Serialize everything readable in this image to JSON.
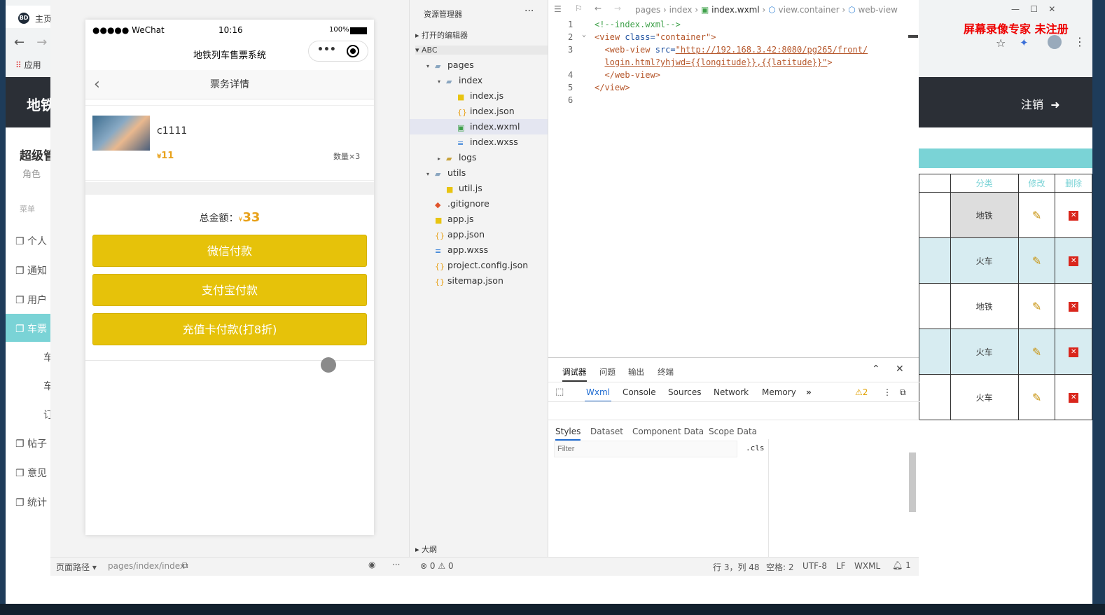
{
  "bg_browser": {
    "tab_label": "主页",
    "apps_label": "应用",
    "brand": "地铁",
    "logout": "注销",
    "side_title": "超级管",
    "side_role": "角色",
    "menu_label": "菜单",
    "side_items": [
      "个人",
      "通知",
      "用户",
      "车票",
      "车",
      "车",
      "订",
      "帖子",
      "意见",
      "统计"
    ],
    "table_headers": [
      "分类",
      "修改",
      "删除"
    ],
    "table_rows": [
      "地铁",
      "火车",
      "地铁",
      "火车",
      "火车"
    ],
    "watermark": "屏幕录像专家  未注册"
  },
  "simulator": {
    "status": {
      "carrier": "●●●●● WeChat",
      "time": "10:16",
      "battery": "100%"
    },
    "nav_title": "地铁列车售票系统",
    "page_title": "票务详情",
    "ticket": {
      "name": "c1111",
      "price_symbol": "¥",
      "price": "11",
      "qty": "数量×3"
    },
    "total_label": "总金额：",
    "total_symbol": "¥",
    "total_value": "33",
    "buttons": [
      "微信付款",
      "支付宝付款",
      "充值卡付款(打8折)"
    ]
  },
  "explorer": {
    "title": "资源管理器",
    "open_editors": "打开的编辑器",
    "project": "ABC",
    "outline": "大纲",
    "tree": [
      {
        "label": "pages",
        "depth": 1,
        "type": "folder-open"
      },
      {
        "label": "index",
        "depth": 2,
        "type": "folder-open"
      },
      {
        "label": "index.js",
        "depth": 3,
        "type": "js"
      },
      {
        "label": "index.json",
        "depth": 3,
        "type": "json"
      },
      {
        "label": "index.wxml",
        "depth": 3,
        "type": "wxml",
        "selected": true
      },
      {
        "label": "index.wxss",
        "depth": 3,
        "type": "wxss"
      },
      {
        "label": "logs",
        "depth": 2,
        "type": "folder"
      },
      {
        "label": "utils",
        "depth": 1,
        "type": "folder-open"
      },
      {
        "label": "util.js",
        "depth": 2,
        "type": "js"
      },
      {
        "label": ".gitignore",
        "depth": 1,
        "type": "git"
      },
      {
        "label": "app.js",
        "depth": 1,
        "type": "js"
      },
      {
        "label": "app.json",
        "depth": 1,
        "type": "json"
      },
      {
        "label": "app.wxss",
        "depth": 1,
        "type": "wxss"
      },
      {
        "label": "project.config.json",
        "depth": 1,
        "type": "json"
      },
      {
        "label": "sitemap.json",
        "depth": 1,
        "type": "json"
      }
    ]
  },
  "editor": {
    "breadcrumb": [
      "pages",
      "index",
      "index.wxml",
      "view.container",
      "web-view"
    ],
    "lines": [
      {
        "n": "1",
        "html": "<span class=\"c-com\">&lt;!--index.wxml--&gt;</span>"
      },
      {
        "n": "2",
        "html": "<span class=\"c-tag\">&lt;view</span> <span class=\"c-attr\">class=</span><span class=\"c-tag\">\"container\"</span><span class=\"c-tag\">&gt;</span>"
      },
      {
        "n": "3",
        "html": "  <span class=\"c-tag\">&lt;web-view</span> <span class=\"c-attr\">src=</span><span class=\"c-str\">\"http://192.168.3.42:8080/pg265/front/</span>"
      },
      {
        "n": "",
        "html": "  <span class=\"c-str\">login.html?yhjwd={{longitude}},{{latitude}}\"</span><span class=\"c-tag\">&gt;</span>"
      },
      {
        "n": "4",
        "html": "  <span class=\"c-tag\">&lt;/web-view&gt;</span>"
      },
      {
        "n": "5",
        "html": "<span class=\"c-tag\">&lt;/view&gt;</span>"
      },
      {
        "n": "6",
        "html": ""
      }
    ]
  },
  "debugger": {
    "tabs": [
      "调试器",
      "问题",
      "输出",
      "终端"
    ],
    "devtools_tabs": [
      "Wxml",
      "Console",
      "Sources",
      "Network",
      "Memory"
    ],
    "warnings": "2",
    "style_tabs": [
      "Styles",
      "Dataset",
      "Component Data",
      "Scope Data"
    ],
    "filter_placeholder": "Filter",
    "cls": ".cls"
  },
  "statusbar": {
    "page_path_label": "页面路径",
    "page_path": "pages/index/index",
    "errors": "0",
    "warnings": "0",
    "cursor": "行 3，列 48",
    "spaces": "空格: 2",
    "encoding": "UTF-8",
    "eol": "LF",
    "lang": "WXML",
    "notifications": "1"
  }
}
